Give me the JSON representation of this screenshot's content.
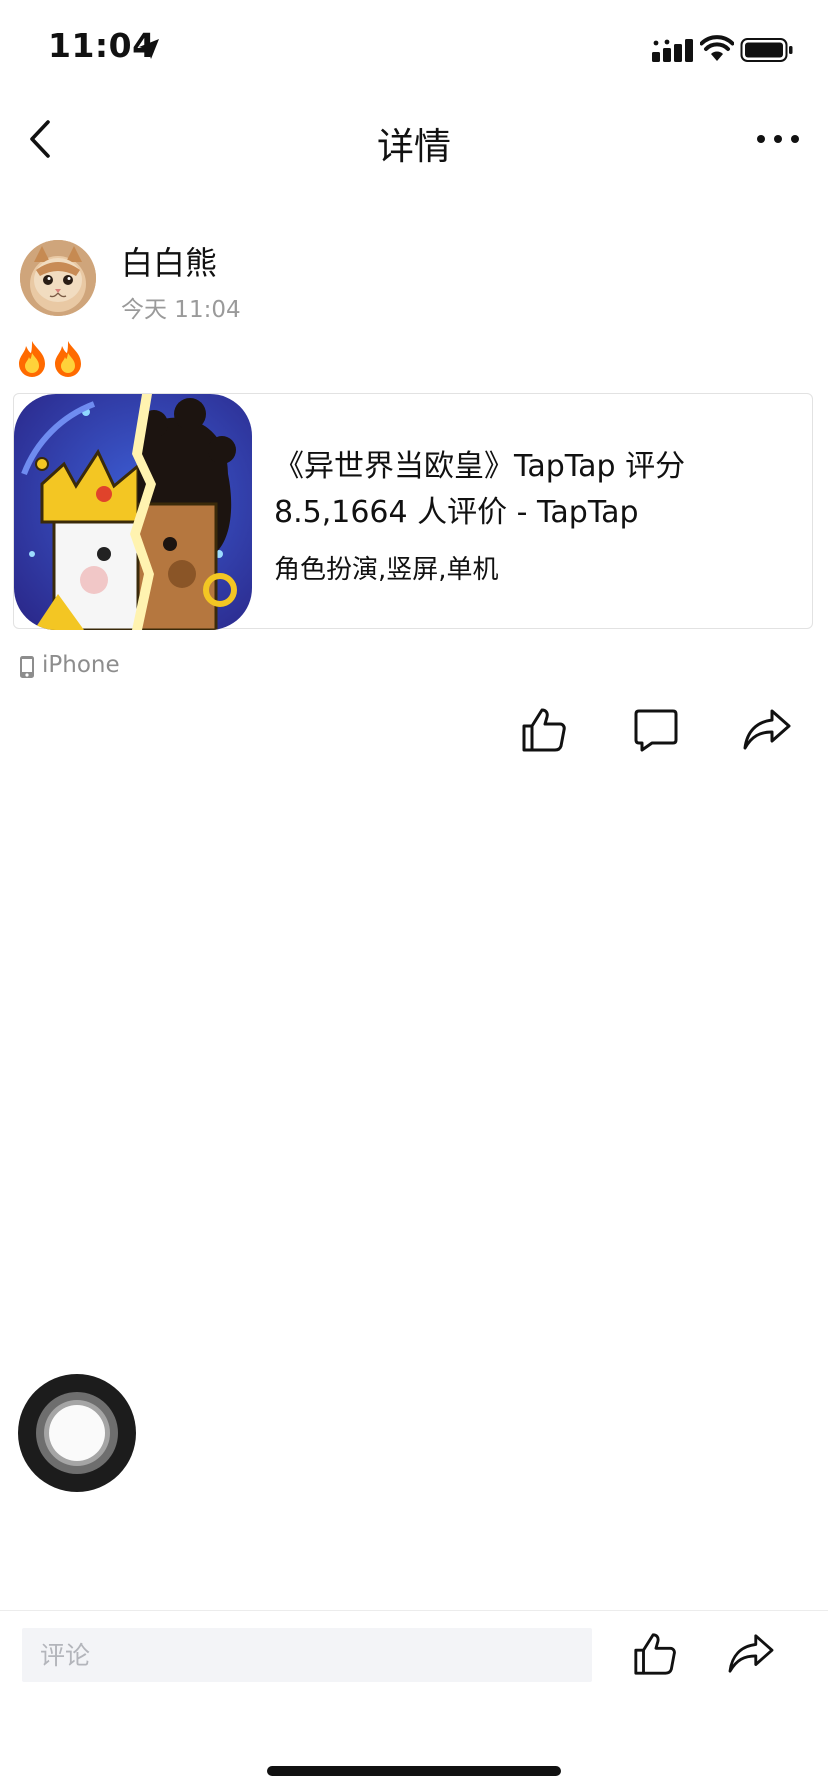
{
  "status_bar": {
    "time": "11:04"
  },
  "nav": {
    "title": "详情"
  },
  "post": {
    "author": "白白熊",
    "time": "今天 11:04",
    "content_emojis": "🔥🔥",
    "device": "iPhone"
  },
  "link_card": {
    "title": "《异世界当欧皇》TapTap 评分 8.5,1664 人评价 - TapTap",
    "tags": "角色扮演,竖屏,单机"
  },
  "comment_bar": {
    "placeholder": "评论"
  },
  "icons": {
    "status": [
      "location-arrow-icon",
      "signal-icon",
      "wifi-icon",
      "battery-icon"
    ],
    "nav": [
      "back-icon",
      "more-icon"
    ],
    "actions": [
      "thumbs-up-icon",
      "comment-icon",
      "share-icon"
    ]
  },
  "colors": {
    "background": "#ffffff",
    "text_primary": "#111111",
    "text_secondary": "#9a9a9a",
    "input_bg": "#f3f4f7",
    "card_border": "#e2e2e2"
  }
}
